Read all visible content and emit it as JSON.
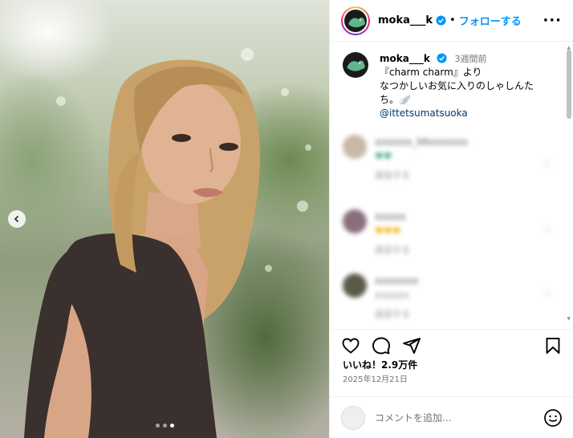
{
  "post": {
    "username": "moka___k",
    "follow_label": "フォローする",
    "separator": "•",
    "more_label": "···"
  },
  "caption": {
    "username": "moka___k",
    "time": "3週間前",
    "line1": "『charm charm』より",
    "line2": "なつかしいお気に入りのしゃしんた",
    "line3": "ち。🪽",
    "mention": "@ittetsumatsuoka"
  },
  "comments": [
    {
      "name": "xxxxxx_hhxxxxxx",
      "text": "♥♥",
      "reply": "返信する"
    },
    {
      "name": "xxxxx",
      "text": "♥♥♥",
      "reply": "返信する"
    },
    {
      "name": "xxxxxxx",
      "text": "xxxxxx",
      "reply": "返信する"
    }
  ],
  "engagement": {
    "likes": "いいね！2.9万件",
    "date": "2025年12月21日"
  },
  "composer": {
    "placeholder": "コメントを追加..."
  },
  "carousel": {
    "slides": 3,
    "active": 3
  },
  "colors": {
    "accent": "#0095f6",
    "mention": "#00376b",
    "muted": "#737373"
  }
}
